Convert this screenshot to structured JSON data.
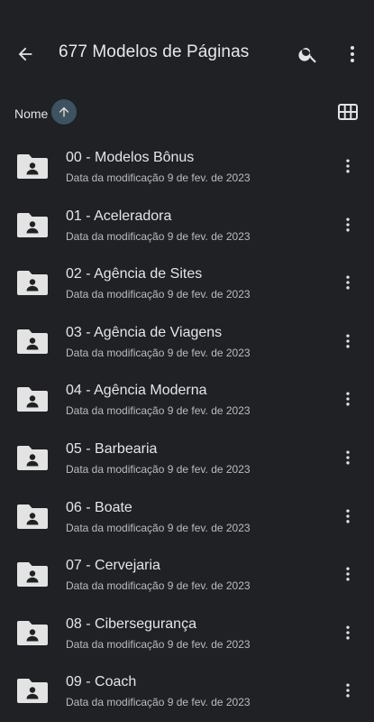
{
  "header": {
    "title": "677 Modelos de Páginas",
    "back_icon": "arrow-back-icon",
    "search_icon": "search-icon",
    "more_icon": "more-vert-icon"
  },
  "sort": {
    "label": "Nome",
    "direction_icon": "arrow-up-icon",
    "view_icon": "grid-view-icon"
  },
  "files": [
    {
      "name": "00 - Modelos Bônus",
      "meta": "Data da modificação 9 de fev. de 2023"
    },
    {
      "name": "01 - Aceleradora",
      "meta": "Data da modificação 9 de fev. de 2023"
    },
    {
      "name": "02 - Agência de Sites",
      "meta": "Data da modificação 9 de fev. de 2023"
    },
    {
      "name": "03 - Agência de Viagens",
      "meta": "Data da modificação 9 de fev. de 2023"
    },
    {
      "name": "04 - Agência Moderna",
      "meta": "Data da modificação 9 de fev. de 2023"
    },
    {
      "name": "05 - Barbearia",
      "meta": "Data da modificação 9 de fev. de 2023"
    },
    {
      "name": "06 - Boate",
      "meta": "Data da modificação 9 de fev. de 2023"
    },
    {
      "name": "07 - Cervejaria",
      "meta": "Data da modificação 9 de fev. de 2023"
    },
    {
      "name": "08 - Cibersegurança",
      "meta": "Data da modificação 9 de fev. de 2023"
    },
    {
      "name": "09 - Coach",
      "meta": "Data da modificação 9 de fev. de 2023"
    }
  ],
  "colors": {
    "background": "#1f2125",
    "icon": "#e3e3e3",
    "sort_button": "#3e5262"
  }
}
